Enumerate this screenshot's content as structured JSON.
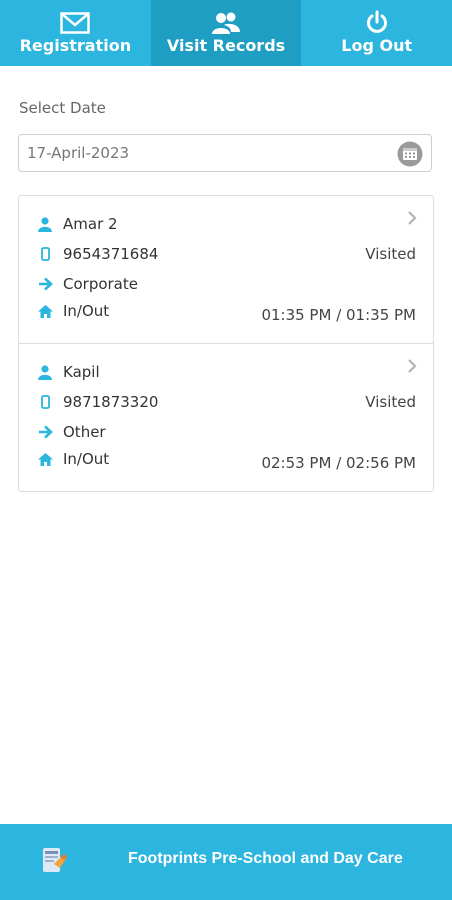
{
  "nav": {
    "tabs": [
      {
        "label": "Registration",
        "icon": "envelope-icon"
      },
      {
        "label": "Visit Records",
        "icon": "users-icon"
      },
      {
        "label": "Log Out",
        "icon": "power-icon"
      }
    ],
    "active_tab": "Visit Records"
  },
  "date_filter": {
    "label": "Select Date",
    "value": "17-April-2023",
    "icon": "calendar-icon"
  },
  "visits": [
    {
      "name": "Amar 2",
      "phone": "9654371684",
      "status": "Visited",
      "type": "Corporate",
      "inout_label": "In/Out",
      "times": "01:35 PM /  01:35 PM"
    },
    {
      "name": "Kapil",
      "phone": "9871873320",
      "status": "Visited",
      "type": "Other",
      "inout_label": "In/Out",
      "times": "02:53 PM /  02:56 PM"
    }
  ],
  "footer": {
    "title": "Footprints Pre-School and Day Care",
    "logo_icon": "app-logo-icon"
  },
  "colors": {
    "primary": "#2cb5de",
    "active_tab": "#1f9ec4",
    "icon_accent": "#2cb5de"
  }
}
